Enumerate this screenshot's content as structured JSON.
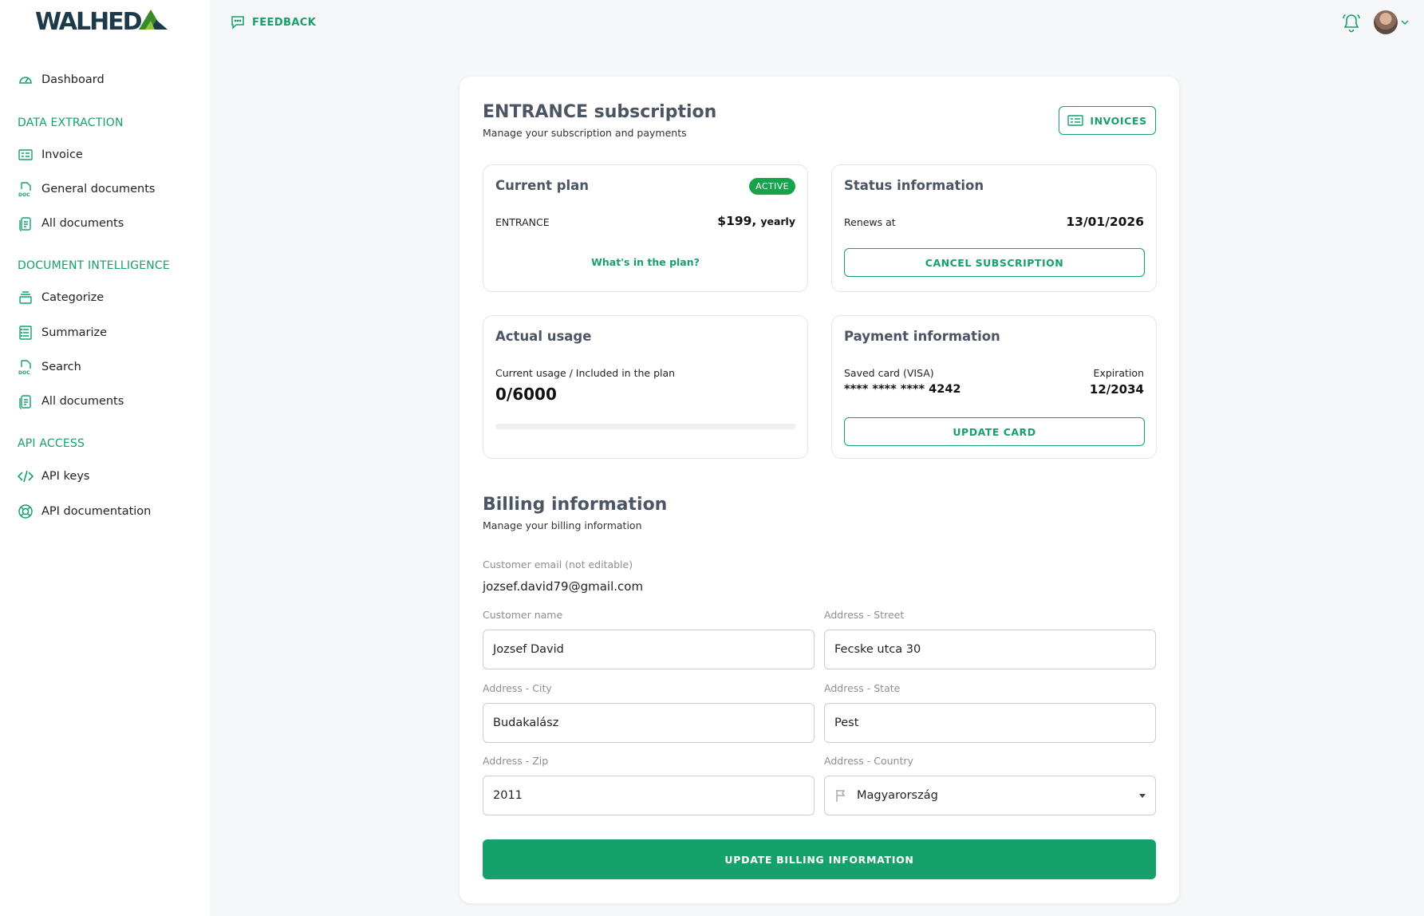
{
  "brand": {
    "logo_text": "WALHEDA",
    "color": "#16a06b"
  },
  "sidebar": {
    "items": [
      {
        "label": "Dashboard",
        "icon": "gauge-icon"
      }
    ],
    "sections": [
      {
        "title": "DATA EXTRACTION",
        "items": [
          {
            "label": "Invoice",
            "icon": "invoice-icon"
          },
          {
            "label": "General documents",
            "icon": "doc-icon"
          },
          {
            "label": "All documents",
            "icon": "documents-icon"
          }
        ]
      },
      {
        "title": "DOCUMENT INTELLIGENCE",
        "items": [
          {
            "label": "Categorize",
            "icon": "layers-icon"
          },
          {
            "label": "Summarize",
            "icon": "list-icon"
          },
          {
            "label": "Search",
            "icon": "doc-icon"
          },
          {
            "label": "All documents",
            "icon": "documents-icon"
          }
        ]
      },
      {
        "title": "API ACCESS",
        "items": [
          {
            "label": "API keys",
            "icon": "code-icon"
          },
          {
            "label": "API documentation",
            "icon": "lifebuoy-icon"
          }
        ]
      }
    ]
  },
  "topbar": {
    "feedback_label": "FEEDBACK"
  },
  "subscription": {
    "title": "ENTRANCE subscription",
    "subtitle": "Manage your subscription and payments",
    "invoices_label": "INVOICES",
    "current_plan": {
      "title": "Current plan",
      "badge": "ACTIVE",
      "plan_name": "ENTRANCE",
      "price": "$199,",
      "period": "yearly",
      "link": "What's in the plan?"
    },
    "status": {
      "title": "Status information",
      "renews_label": "Renews at",
      "renews_date": "13/01/2026",
      "cancel_label": "CANCEL SUBSCRIPTION"
    },
    "usage": {
      "title": "Actual usage",
      "label": "Current usage / Included in the plan",
      "value": "0/6000",
      "progress_fraction": 0
    },
    "payment": {
      "title": "Payment information",
      "card_label": "Saved card (VISA)",
      "card_number": "**** **** **** 4242",
      "expiration_label": "Expiration",
      "expiration_value": "12/2034",
      "update_label": "UPDATE CARD"
    }
  },
  "billing": {
    "title": "Billing information",
    "subtitle": "Manage your billing information",
    "email_label": "Customer email (not editable)",
    "email": "jozsef.david79@gmail.com",
    "name_label": "Customer name",
    "name": "Jozsef David",
    "street_label": "Address - Street",
    "street": "Fecske utca 30",
    "city_label": "Address - City",
    "city": "Budakalász",
    "state_label": "Address - State",
    "state": "Pest",
    "zip_label": "Address - Zip",
    "zip": "2011",
    "country_label": "Address - Country",
    "country": "Magyarország",
    "submit_label": "UPDATE BILLING INFORMATION"
  }
}
